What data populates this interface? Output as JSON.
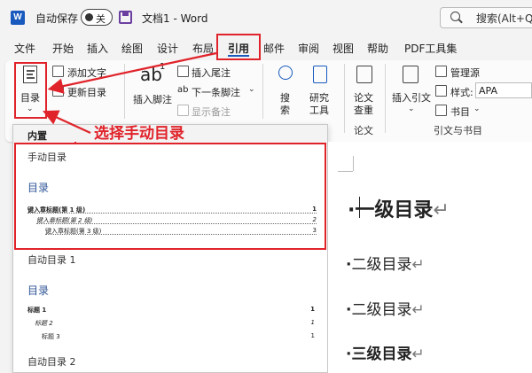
{
  "titlebar": {
    "app_logo_letter": "W",
    "autosave_label": "自动保存",
    "autosave_state": "关",
    "doc_title": "文档1 - Word",
    "search_text": "搜索(Alt+Q"
  },
  "tabs": [
    "文件",
    "开始",
    "插入",
    "绘图",
    "设计",
    "布局",
    "引用",
    "邮件",
    "审阅",
    "视图",
    "帮助",
    "PDF工具集"
  ],
  "active_tab": "引用",
  "ribbon": {
    "toc_button": "目录",
    "add_text": "添加文字",
    "update_toc": "更新目录",
    "insert_footnote_icon": "ab",
    "insert_footnote_sup": "1",
    "insert_footnote": "插入脚注",
    "insert_endnote": "插入尾注",
    "next_footnote": "下一条脚注",
    "show_notes": "显示备注",
    "search_top": "搜",
    "search_bottom": "索",
    "research_top": "研究",
    "research_bottom": "工具",
    "paper_top": "论文",
    "paper_bottom": "查重",
    "paper_group": "论文",
    "insert_citation": "插入引文",
    "manage_sources": "管理源",
    "style_label": "样式:",
    "style_value": "APA",
    "bibliography": "书目",
    "citations_group": "引文与书目"
  },
  "annotation": "选择手动目录",
  "panel": {
    "header": "内置",
    "manual_toc": {
      "title": "手动目录",
      "heading": "目录",
      "entries": [
        {
          "text": "键入章标题(第 1 级)",
          "page": "1"
        },
        {
          "text": "键入章标题(第 2 级)",
          "page": "2"
        },
        {
          "text": "键入章标题(第 3 级)",
          "page": "3"
        }
      ]
    },
    "auto_toc_1": {
      "title": "自动目录 1",
      "heading": "目录",
      "entries": [
        {
          "text": "标题 1",
          "page": "1"
        },
        {
          "text": "标题 2",
          "page": "1"
        },
        {
          "text": "标题 3",
          "page": "1"
        }
      ]
    },
    "auto_toc_2": {
      "title": "自动目录 2"
    }
  },
  "document": {
    "lines": [
      {
        "text": "一级目录",
        "mark": "↵"
      },
      {
        "text": "二级目录",
        "mark": "↵"
      },
      {
        "text": "二级目录",
        "mark": "↵"
      },
      {
        "text": "三级目录",
        "mark": "↵"
      }
    ],
    "bullet": "·"
  },
  "colors": {
    "highlight": "#e0232a",
    "word_blue": "#185abd",
    "toc_heading": "#2f5597"
  },
  "icons": [
    "word-logo-icon",
    "save-icon",
    "search-icon",
    "toc-icon",
    "add-text-icon",
    "update-toc-icon",
    "insert-endnote-icon",
    "next-footnote-icon",
    "show-notes-icon",
    "search-tool-icon",
    "research-tool-icon",
    "paper-check-icon",
    "insert-citation-icon",
    "manage-sources-icon",
    "bibliography-icon"
  ]
}
